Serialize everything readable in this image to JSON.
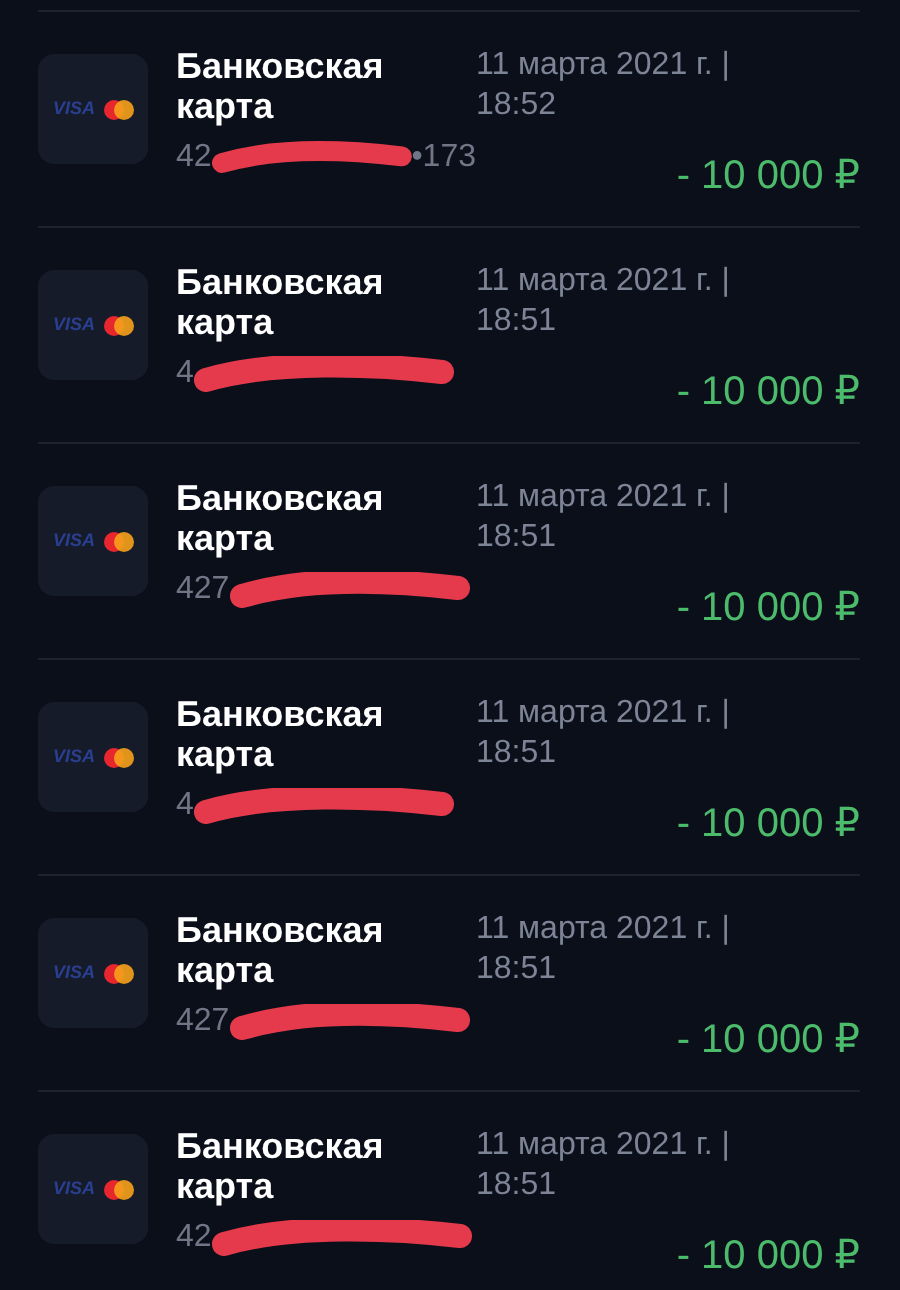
{
  "transactions": [
    {
      "brand": "VISA",
      "title": "Банковская карта",
      "number_prefix": "42",
      "number_suffix": "•173",
      "date": "11 марта 2021 г. | 18:52",
      "amount": "- 10 000 ₽"
    },
    {
      "brand": "VISA",
      "title": "Банковская карта",
      "number_prefix": "4",
      "date": "11 марта 2021 г. | 18:51",
      "amount": "- 10 000 ₽"
    },
    {
      "brand": "VISA",
      "title": "Банковская карта",
      "number_prefix": "427",
      "date": "11 марта 2021 г. | 18:51",
      "amount": "- 10 000 ₽"
    },
    {
      "brand": "VISA",
      "title": "Банковская карта",
      "number_prefix": "4",
      "date": "11 марта 2021 г. | 18:51",
      "amount": "- 10 000 ₽"
    },
    {
      "brand": "VISA",
      "title": "Банковская карта",
      "number_prefix": "427",
      "date": "11 марта 2021 г. | 18:51",
      "amount": "- 10 000 ₽"
    },
    {
      "brand": "VISA",
      "title": "Банковская карта",
      "number_prefix": "42",
      "date": "11 марта 2021 г. | 18:51",
      "amount": "- 10 000 ₽"
    }
  ]
}
